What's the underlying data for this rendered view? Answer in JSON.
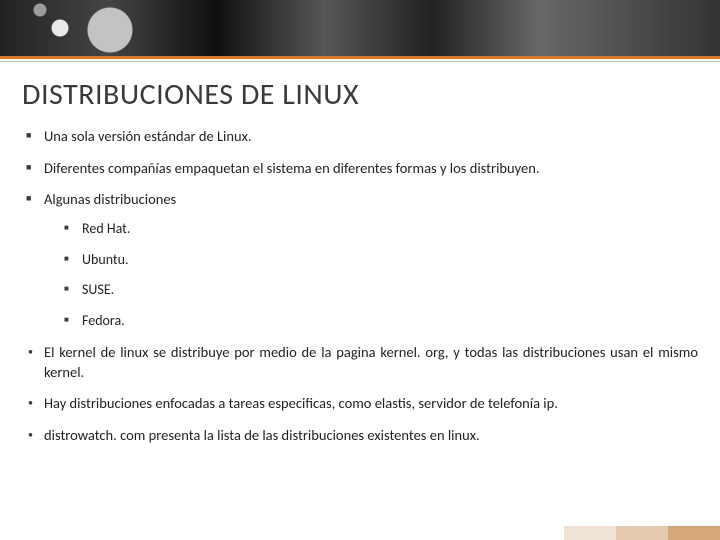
{
  "title": "DISTRIBUCIONES DE LINUX",
  "bullets": {
    "b0": "Una sola versión estándar de Linux.",
    "b1": "Diferentes compañías empaquetan el sistema en diferentes formas y los distribuyen.",
    "b2": "Algunas distribuciones",
    "sub": {
      "s0": "Red Hat.",
      "s1": "Ubuntu.",
      "s2": "SUSE.",
      "s3": "Fedora."
    },
    "b3": "El kernel de linux se distribuye por medio de la pagina kernel. org, y todas las distribuciones usan el mismo kernel.",
    "b4": "Hay distribuciones enfocadas a tareas especificas, como elastis, servidor de telefonía ip.",
    "b5": "distrowatch. com presenta la lista de las distribuciones existentes en linux."
  }
}
